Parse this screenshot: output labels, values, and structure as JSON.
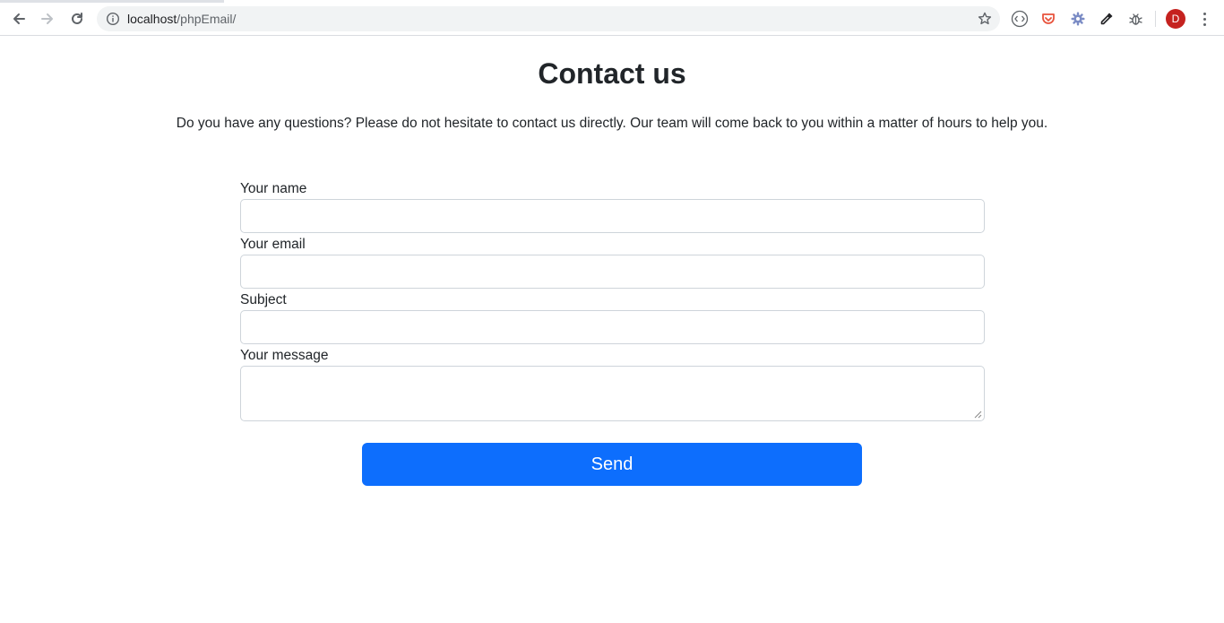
{
  "browser": {
    "url_host": "localhost",
    "url_path": "/phpEmail/",
    "profile_initial": "D",
    "icons": {
      "back": "arrow-left-icon",
      "forward": "arrow-right-icon",
      "reload": "reload-icon",
      "info": "info-icon",
      "bookmark": "star-icon",
      "extensions": [
        "code-viewer-icon",
        "pocket-icon",
        "gear-icon",
        "eyedropper-icon",
        "bug-icon"
      ],
      "menu": "more-vert-icon"
    }
  },
  "page": {
    "title": "Contact us",
    "intro": "Do you have any questions? Please do not hesitate to contact us directly. Our team will come back to you within a matter of hours to help you."
  },
  "form": {
    "name_label": "Your name",
    "name_value": "",
    "email_label": "Your email",
    "email_value": "",
    "subject_label": "Subject",
    "subject_value": "",
    "message_label": "Your message",
    "message_value": "",
    "send_label": "Send"
  },
  "colors": {
    "primary": "#0d6efd",
    "text": "#212529",
    "input_border": "#ced4da",
    "avatar": "#c5221f"
  }
}
